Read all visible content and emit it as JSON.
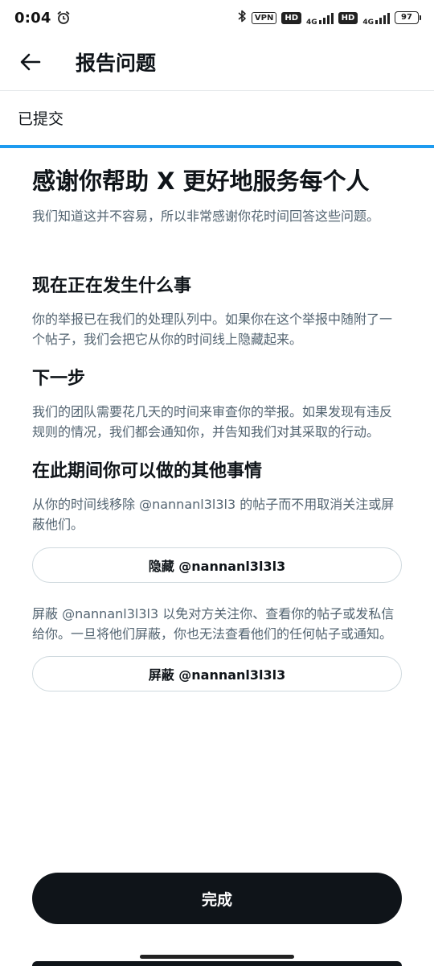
{
  "status_bar": {
    "time": "0:04",
    "vpn": "VPN",
    "hd1": "HD",
    "net1": "4G",
    "hd2": "HD",
    "net2": "4G",
    "battery": "97",
    "icons": [
      "alarm-icon",
      "bluetooth-icon",
      "signal-icon",
      "battery-icon"
    ]
  },
  "header": {
    "title": "报告问题",
    "back_icon": "arrow-left-icon"
  },
  "submitted": {
    "label": "已提交"
  },
  "main": {
    "headline": "感谢你帮助 X 更好地服务每个人",
    "subtext": "我们知道这并不容易，所以非常感谢你花时间回答这些问题。",
    "sections": [
      {
        "title": "现在正在发生什么事",
        "body": "你的举报已在我们的处理队列中。如果你在这个举报中随附了一个帖子，我们会把它从你的时间线上隐藏起来。"
      },
      {
        "title": "下一步",
        "body": "我们的团队需要花几天的时间来审查你的举报。如果发现有违反规则的情况，我们都会通知你，并告知我们对其采取的行动。"
      },
      {
        "title": "在此期间你可以做的其他事情",
        "body": "从你的时间线移除 @nannanl3l3l3 的帖子而不用取消关注或屏蔽他们。"
      }
    ],
    "hide_button": "隐藏 @nannanl3l3l3",
    "block_text": "屏蔽 @nannanl3l3l3 以免对方关注你、查看你的帖子或发私信给你。一旦将他们屏蔽，你也无法查看他们的任何帖子或通知。",
    "block_button": "屏蔽 @nannanl3l3l3"
  },
  "footer": {
    "done_button": "完成"
  },
  "colors": {
    "accent": "#1d9bf0",
    "text_primary": "#0f1419",
    "text_secondary": "#536471",
    "button_dark": "#0f1419"
  }
}
